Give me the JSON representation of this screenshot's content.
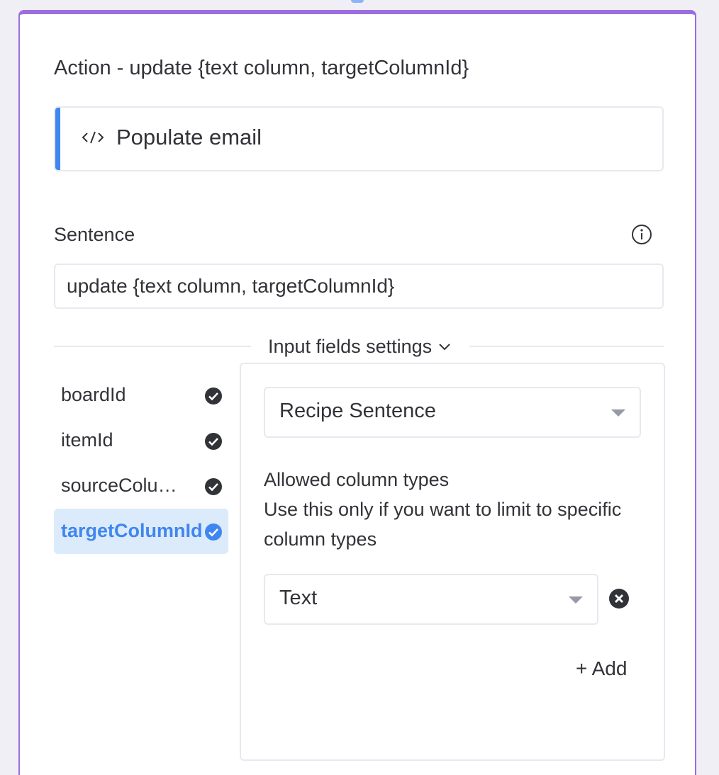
{
  "dialog": {
    "title": "Action - update {text column, targetColumnId}",
    "code_name": "Populate email",
    "code_icon": "code-icon"
  },
  "sentence": {
    "label": "Sentence",
    "value": "update {text column, targetColumnId}",
    "info_icon": "info-icon"
  },
  "input_fields": {
    "toggle_label": "Input fields settings",
    "items": [
      {
        "name": "boardId",
        "status_icon": "check-circle-icon",
        "active": false
      },
      {
        "name": "itemId",
        "status_icon": "check-circle-icon",
        "active": false
      },
      {
        "name": "sourceColumnId",
        "status_icon": "check-circle-icon",
        "active": false
      },
      {
        "name": "targetColumnId",
        "status_icon": "check-circle-icon",
        "active": true
      }
    ]
  },
  "field_settings": {
    "source_select": "Recipe Sentence",
    "allowed_types_title": "Allowed column types",
    "allowed_types_hint": "Use this only if you want to limit to specific column types",
    "column_type_value": "Text",
    "add_label": "+ Add"
  },
  "colors": {
    "panel_border": "#9d6ddf",
    "accent_blue": "#3f86f0",
    "active_bg": "#dcebfb",
    "text": "#323338"
  }
}
